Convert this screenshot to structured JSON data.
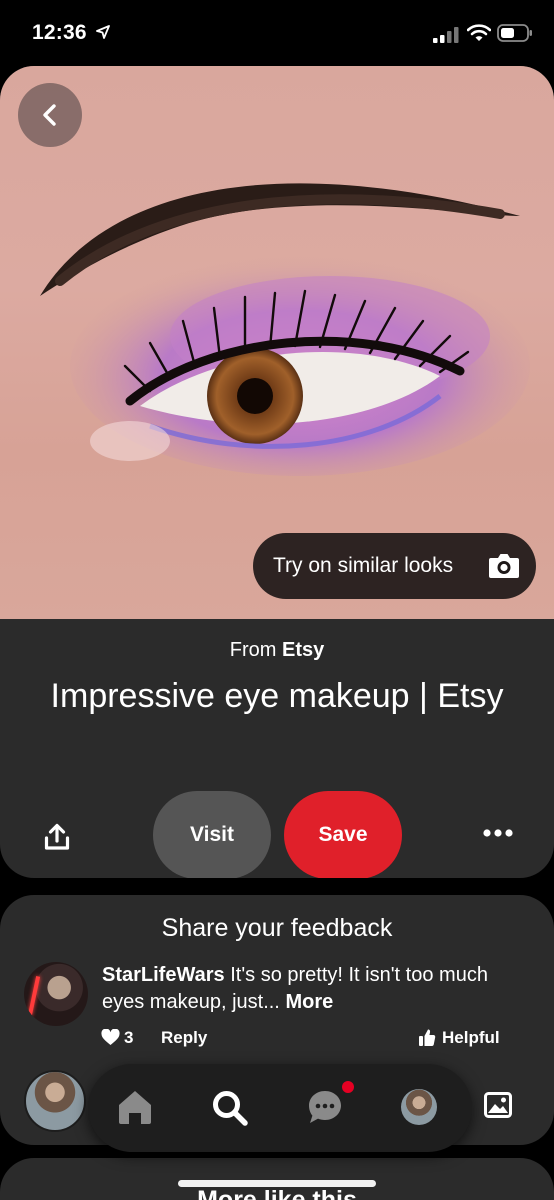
{
  "status_bar": {
    "time": "12:36"
  },
  "pin": {
    "image_description_icon": "eye-makeup-photo",
    "try_on_label": "Try on similar looks",
    "source_prefix": "From",
    "source_name": "Etsy",
    "title": "Impressive eye makeup | Etsy",
    "visit_label": "Visit",
    "save_label": "Save"
  },
  "feedback": {
    "title": "Share your feedback",
    "comment": {
      "author": "StarLifeWars",
      "text": "It's so pretty! It isn't too much eyes makeup, just...",
      "more_label": "More",
      "likes": "3",
      "reply_label": "Reply",
      "helpful_label": "Helpful"
    }
  },
  "more_like_this": {
    "title": "More like this"
  },
  "colors": {
    "accent_red": "#e0202a",
    "card_bg": "#2b2b2b",
    "nav_bg": "#1e1e1e",
    "visit_bg": "#555555",
    "notification_dot": "#e60023"
  }
}
